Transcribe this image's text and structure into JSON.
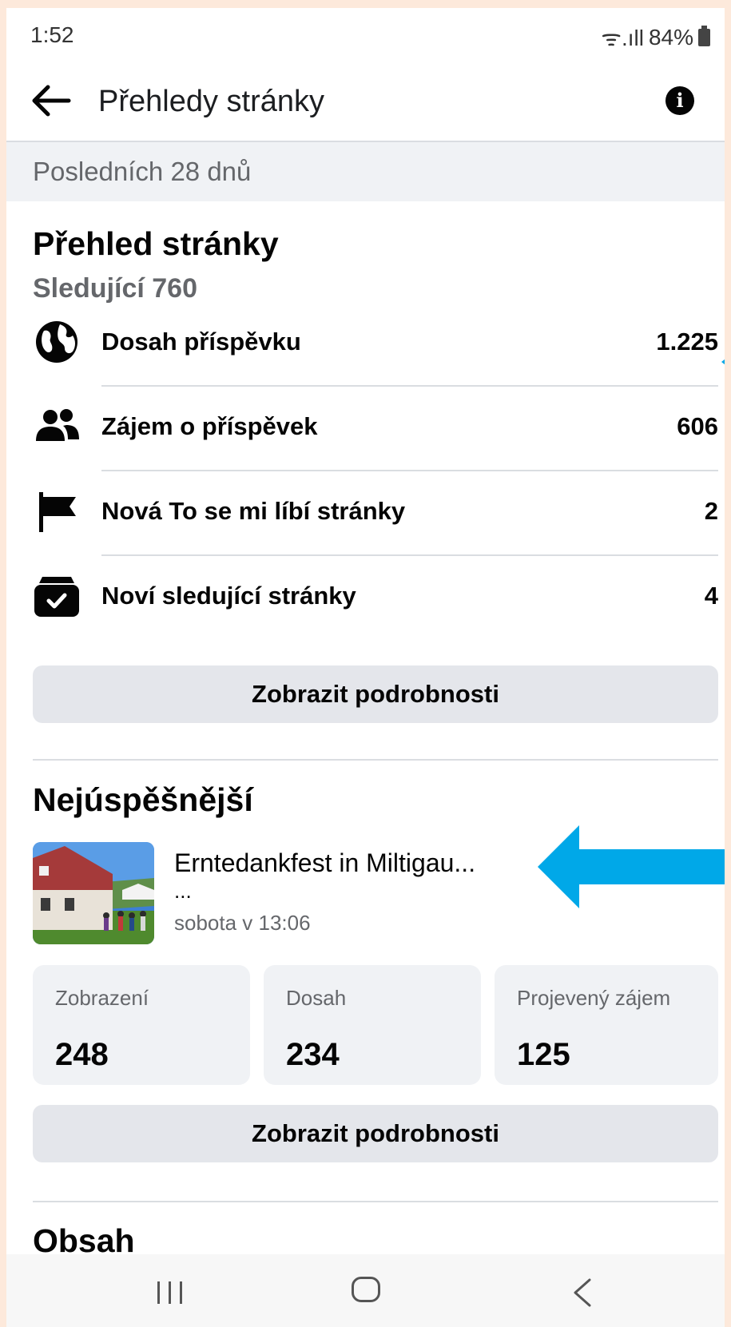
{
  "status": {
    "time": "1:52",
    "signal": "ᯤ.ıll",
    "battery": "84%"
  },
  "appbar": {
    "title": "Přehledy stránky",
    "info_glyph": "i"
  },
  "period": "Posledních 28 dnů",
  "overview": {
    "title": "Přehled stránky",
    "followers": "Sledující 760",
    "metrics": [
      {
        "icon": "globe-icon",
        "label": "Dosah příspěvku",
        "value": "1.225"
      },
      {
        "icon": "people-icon",
        "label": "Zájem o příspěvek",
        "value": "606"
      },
      {
        "icon": "flag-icon",
        "label": "Nová To se mi líbí stránky",
        "value": "2"
      },
      {
        "icon": "follow-check-icon",
        "label": "Noví sledující stránky",
        "value": "4"
      }
    ],
    "details_button": "Zobrazit podrobnosti"
  },
  "top": {
    "title": "Nejúspěšnější",
    "post": {
      "title": "Erntedankfest in Miltigau...",
      "ellipsis": "...",
      "date": "sobota v 13:06"
    },
    "stats": [
      {
        "label": "Zobrazení",
        "value": "248"
      },
      {
        "label": "Dosah",
        "value": "234"
      },
      {
        "label": "Projevený zájem",
        "value": "125"
      }
    ],
    "details_button": "Zobrazit podrobnosti"
  },
  "content": {
    "title": "Obsah"
  },
  "colors": {
    "annotation_arrow": "#00a8e8",
    "card_bg": "#f0f2f5",
    "button_bg": "#e4e6eb"
  }
}
